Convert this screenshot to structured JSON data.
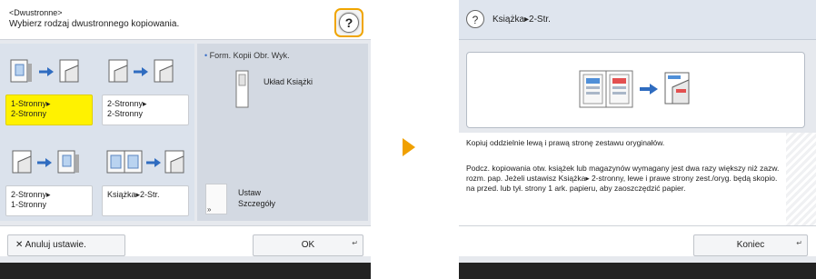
{
  "left_screen": {
    "header": {
      "title_small": "<Dwustronne>",
      "title": "Wybierz rodzaj dwustronnego kopiowania.",
      "help_label": "?"
    },
    "options": [
      {
        "label": "1-Stronny▸\n2-Stronny",
        "selected": true
      },
      {
        "label": "2-Stronny▸\n2-Stronny",
        "selected": false
      },
      {
        "label": "2-Stronny▸\n1-Stronny",
        "selected": false
      },
      {
        "label": "Książka▸2-Str.",
        "selected": false
      }
    ],
    "layout_label": "Form. Kopii Obr. Wyk.",
    "layout_value": "Układ Książki",
    "set_details_label": "Ustaw\nSzczegóły",
    "footer": {
      "cancel_label": "✕  Anuluj ustawie.",
      "ok_label": "OK"
    }
  },
  "right_screen": {
    "header": {
      "help_label": "?",
      "title": "Książka▸2-Str."
    },
    "description_1": "Kopiuj oddzielnie lewą i prawą stronę zestawu oryginałów.",
    "description_2": "Podcz. kopiowania otw. książek lub magazynów wymagany jest dwa razy większy niż zazw. rozm. pap. Jeżeli ustawisz Książka▸ 2-stronny, lewe i prawe strony zest./oryg. będą skopio. na przed. lub tył. strony 1 ark. papieru, aby zaoszczędzić papier.",
    "footer": {
      "close_label": "Koniec"
    }
  },
  "colors": {
    "selected": "#fff200",
    "help_border": "#f0a500",
    "arrow": "#f0a000",
    "panel": "#dbe2ec"
  }
}
